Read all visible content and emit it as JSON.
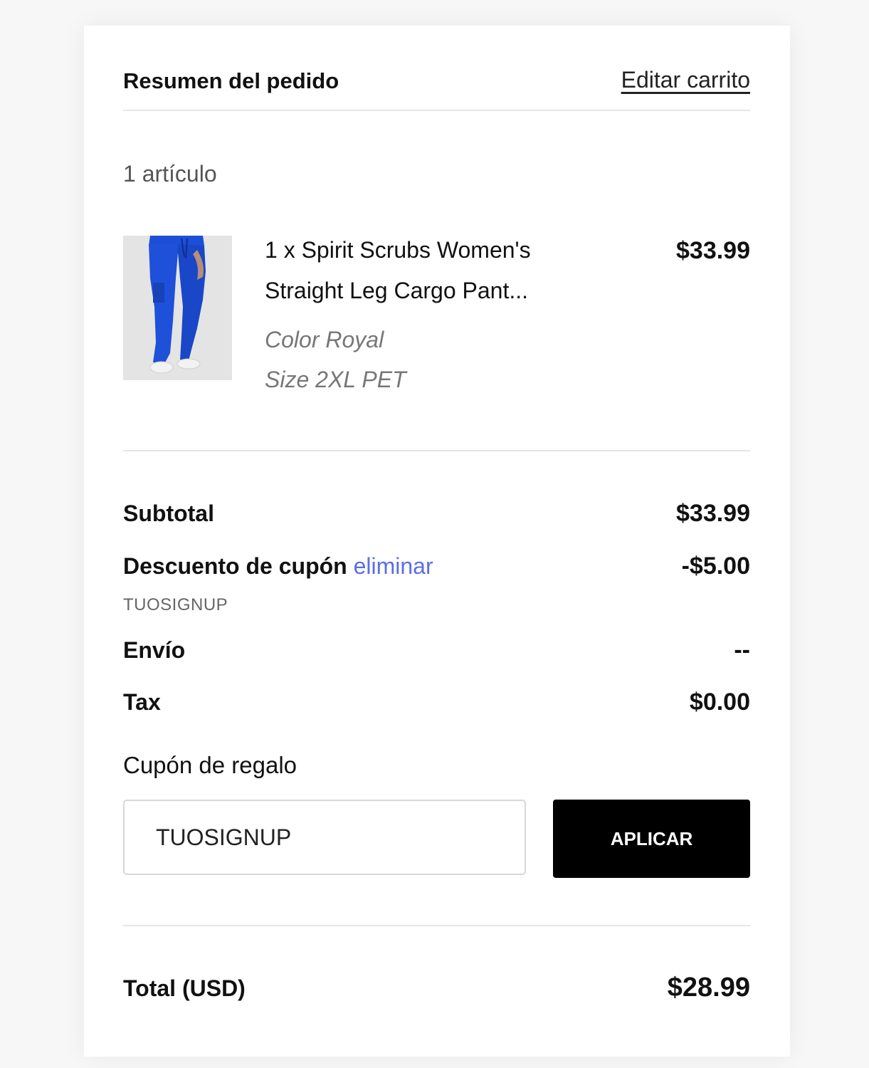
{
  "summary": {
    "title": "Resumen del pedido",
    "edit_cart_label": "Editar carrito",
    "item_count": "1 artículo"
  },
  "items": [
    {
      "name": "1 x Spirit Scrubs Women's Straight Leg Cargo Pant...",
      "color": "Color Royal",
      "size": "Size 2XL PET",
      "price": "$33.99",
      "image_icon": "blue-scrub-pants-image"
    }
  ],
  "totals": {
    "subtotal_label": "Subtotal",
    "subtotal_value": "$33.99",
    "discount_label": "Descuento de cupón",
    "discount_remove_label": "eliminar",
    "discount_value": "-$5.00",
    "discount_code": "TUOSIGNUP",
    "shipping_label": "Envío",
    "shipping_value": "--",
    "tax_label": "Tax",
    "tax_value": "$0.00"
  },
  "gift_coupon": {
    "label": "Cupón de regalo",
    "input_value": "TUOSIGNUP",
    "apply_label": "APLICAR"
  },
  "order_total": {
    "label": "Total (USD)",
    "value": "$28.99"
  },
  "colors": {
    "accent_link": "#5b6ee1",
    "button_bg": "#000000",
    "product_color": "#1f4fd6"
  }
}
